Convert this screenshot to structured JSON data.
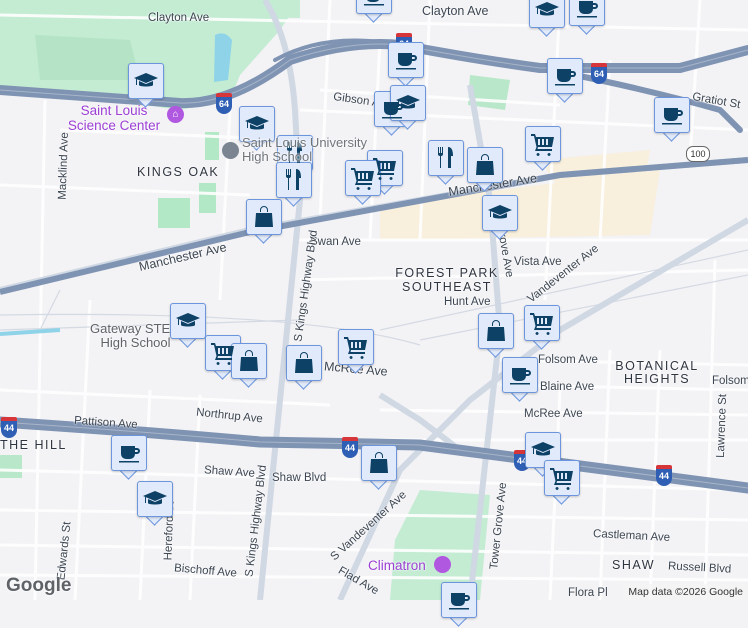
{
  "map": {
    "streets": [
      "Clayton Ave",
      "Clayton Ave",
      "Gibson Ave",
      "Gratiot St",
      "Manchester Ave",
      "Manchester Ave",
      "Swan Ave",
      "Vista Ave",
      "Hunt Ave",
      "Vandeventer Ave",
      "Grove Ave",
      "Macklind Ave",
      "S Kings Highway Blvd",
      "S Kings Highway Blvd",
      "McRee Ave",
      "McRee Ave",
      "Northrup Ave",
      "Pattison Ave",
      "Shaw Ave",
      "Shaw Blvd",
      "S Vandeventer Ave",
      "Tower Grove Ave",
      "Folsom Ave",
      "Folsom Ave",
      "Blaine Ave",
      "Castleman Ave",
      "Russell Blvd",
      "Flora Pl",
      "Flad Ave",
      "Lawrence St",
      "Bischoff Ave",
      "Edwards St",
      "Hereford St"
    ],
    "areas": [
      "KINGS OAK",
      "FOREST PARK SOUTHEAST",
      "BOTANICAL HEIGHTS",
      "THE HILL",
      "SHAW"
    ],
    "pois": [
      "Saint Louis Science Center",
      "Saint Louis University High School",
      "Gateway STEM High School",
      "Climatron"
    ],
    "shields": {
      "interstate_64": "64",
      "interstate_44": "44",
      "route_100": "100"
    }
  },
  "markers": [
    "coffee",
    "school",
    "coffee",
    "school",
    "school",
    "restaurant",
    "restaurant",
    "shopping-bag",
    "grocery-cart",
    "coffee",
    "coffee",
    "school",
    "restaurant",
    "shopping-bag",
    "grocery-cart",
    "coffee",
    "coffee",
    "grocery-cart",
    "school",
    "school",
    "grocery-cart",
    "shopping-bag",
    "shopping-bag",
    "grocery-cart",
    "shopping-bag",
    "grocery-cart",
    "coffee",
    "school",
    "grocery-cart",
    "shopping-bag",
    "coffee",
    "school",
    "coffee"
  ],
  "branding": {
    "logo": "Google",
    "attribution": "Map data ©2026 Google"
  },
  "colors": {
    "marker_fill": "#e1eafb",
    "marker_border": "#6b95dc",
    "icon": "#0d4166",
    "highway": "#8397b4",
    "park": "#bde8cc",
    "background": "#f3f2f5"
  }
}
